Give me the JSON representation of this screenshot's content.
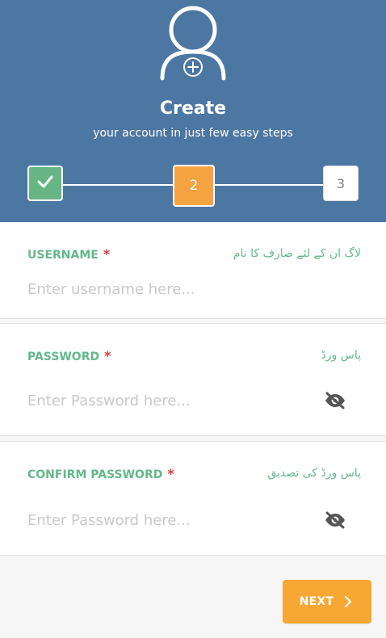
{
  "header": {
    "avatar_icon": "user-add-icon",
    "title": "Create",
    "subtitle": "your account in just few easy steps"
  },
  "stepper": {
    "steps": [
      {
        "label": "",
        "state": "completed",
        "icon": "check-icon"
      },
      {
        "label": "2",
        "state": "active"
      },
      {
        "label": "3",
        "state": "upcoming"
      }
    ]
  },
  "form": {
    "username": {
      "label": "USERNAME",
      "required": "*",
      "urdu_label": "لاگ ان کے لئے صارف کا نام",
      "placeholder": "Enter username here..."
    },
    "password": {
      "label": "PASSWORD",
      "required": "*",
      "urdu_label": "پاس ورڈ",
      "placeholder": "Enter Password here...",
      "toggle_icon": "eye-off-icon"
    },
    "confirm_password": {
      "label": "CONFIRM PASSWORD",
      "required": "*",
      "urdu_label": "پاس ورڈ کی تصدیق",
      "placeholder": "Enter Password here...",
      "toggle_icon": "eye-off-icon"
    }
  },
  "actions": {
    "next_label": "NEXT",
    "next_icon": "chevron-right-icon"
  },
  "colors": {
    "header": "#4d77a3",
    "accent": "#f7a733",
    "success": "#67b585",
    "label": "#63b88c",
    "required": "#d93a3a"
  }
}
